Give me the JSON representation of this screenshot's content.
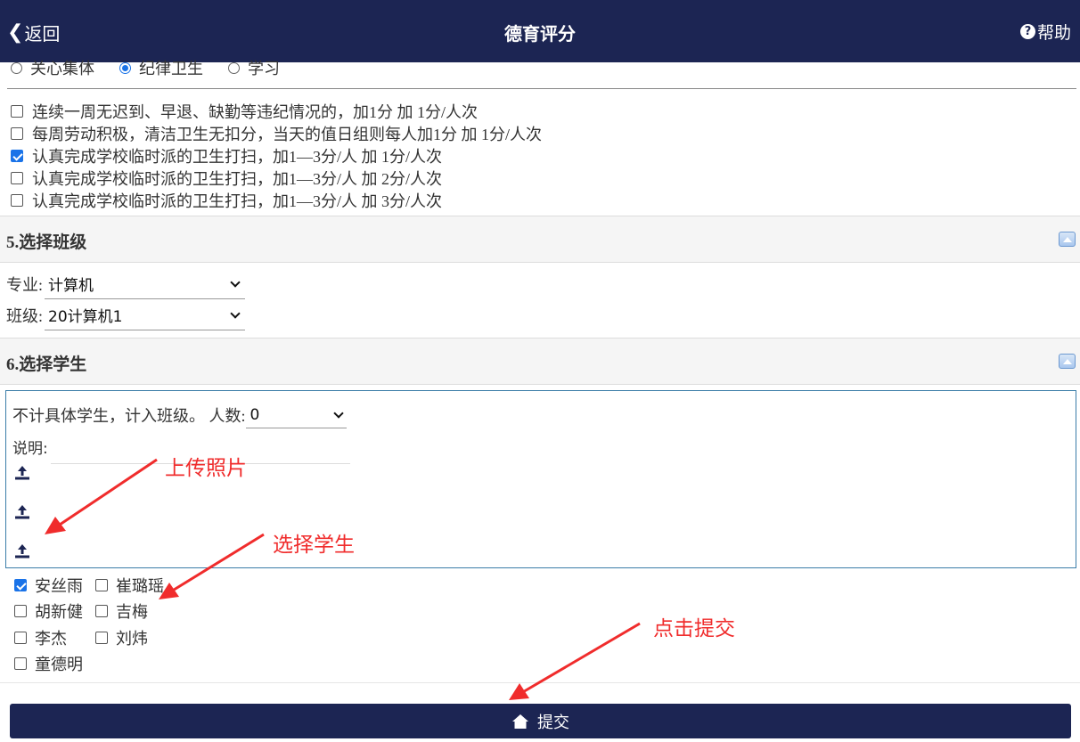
{
  "header": {
    "back_label": "返回",
    "title": "德育评分",
    "help_label": "帮助"
  },
  "category_radios": [
    {
      "label": "关心集体",
      "checked": false
    },
    {
      "label": "纪律卫生",
      "checked": true
    },
    {
      "label": "学习",
      "checked": false
    }
  ],
  "criteria": [
    {
      "label": "连续一周无迟到、早退、缺勤等违纪情况的，加1分 加 1分/人次",
      "checked": false
    },
    {
      "label": "每周劳动积极，清洁卫生无扣分，当天的值日组则每人加1分 加 1分/人次",
      "checked": false
    },
    {
      "label": "认真完成学校临时派的卫生打扫，加1—3分/人 加 1分/人次",
      "checked": true
    },
    {
      "label": "认真完成学校临时派的卫生打扫，加1—3分/人 加 2分/人次",
      "checked": false
    },
    {
      "label": "认真完成学校临时派的卫生打扫，加1—3分/人 加 3分/人次",
      "checked": false
    }
  ],
  "section_class": {
    "title": "5.选择班级",
    "major_label": "专业:",
    "major_value": "计算机",
    "class_label": "班级:",
    "class_value": "20计算机1"
  },
  "section_student": {
    "title": "6.选择学生",
    "no_student_text": "不计具体学生，计入班级。 人数:",
    "count_value": "0",
    "note_label": "说明:"
  },
  "students": [
    {
      "name": "安丝雨",
      "checked": true
    },
    {
      "name": "崔璐瑶",
      "checked": false
    },
    {
      "name": "胡新健",
      "checked": false
    },
    {
      "name": "吉梅",
      "checked": false
    },
    {
      "name": "李杰",
      "checked": false
    },
    {
      "name": "刘炜",
      "checked": false
    },
    {
      "name": "童德明",
      "checked": false
    }
  ],
  "submit_label": "提交",
  "annotations": {
    "upload_photo": "上传照片",
    "select_student": "选择学生",
    "click_submit": "点击提交"
  },
  "colors": {
    "header_bg": "#1c2553",
    "accent": "#1a73e8",
    "annotation": "#f02c2c"
  },
  "icons": [
    "chevron-left-icon",
    "help-circle-icon",
    "collapse-up-icon",
    "upload-icon",
    "home-icon"
  ]
}
